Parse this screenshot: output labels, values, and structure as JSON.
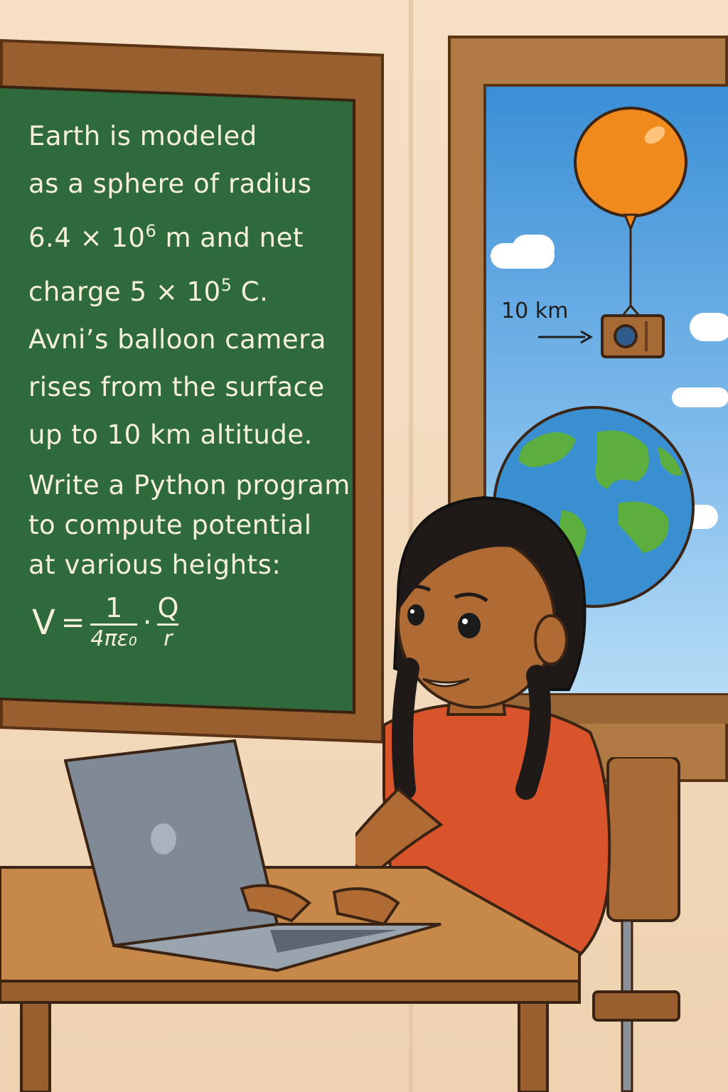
{
  "chalkboard": {
    "problem_lines": [
      "Earth is modeled",
      "as a sphere of radius",
      "6.4 × 10",
      "m and net",
      "charge 5 × 10",
      " C.",
      "Avni’s balloon camera",
      "rises from the surface",
      "up to 10 km altitude."
    ],
    "radius_exponent": "6",
    "charge_exponent": "5",
    "task_lines": [
      "Write a Python program",
      "to compute potential",
      "at various heights:"
    ],
    "formula": {
      "lhs": "V",
      "equals": "=",
      "frac1_num": "1",
      "frac1_den": "4πε₀",
      "dot": "·",
      "frac2_num": "Q",
      "frac2_den": "r"
    }
  },
  "window": {
    "altitude_label": "10 km"
  },
  "colors": {
    "chalkboard": "#2f6b3a",
    "frame": "#9a5f2e",
    "sky": "#3b8fd6",
    "balloon": "#f08a1c",
    "shirt": "#d9542a",
    "laptop": "#7f8a96"
  },
  "icons": [
    "balloon-icon",
    "camera-icon",
    "earth-icon",
    "arrow-right-icon",
    "laptop-icon"
  ]
}
